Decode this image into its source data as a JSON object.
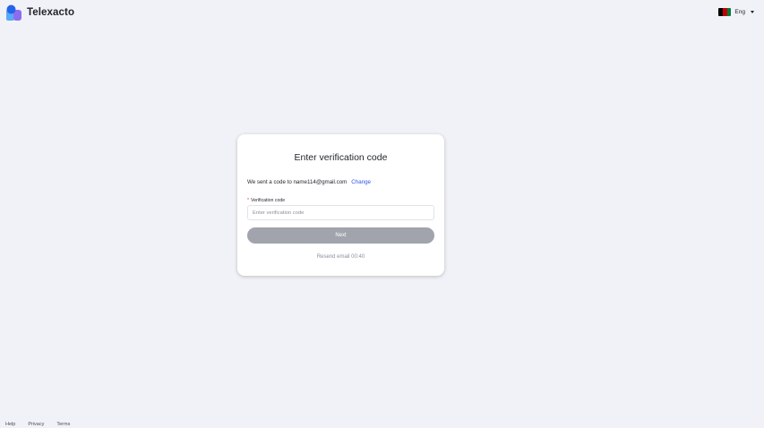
{
  "header": {
    "brand": "Telexacto",
    "language": {
      "label": "Eng",
      "flag_colors": [
        "#000000",
        "#be0000",
        "#007a36"
      ]
    }
  },
  "card": {
    "title": "Enter verification code",
    "sent_text": "We sent a code to name114@gmail.com",
    "change_label": "Change",
    "field_required_mark": "*",
    "field_label": "Verification code",
    "field_placeholder": "Enter verification code",
    "field_value": "",
    "next_label": "Next",
    "resend_text": "Resend email 00:40"
  },
  "footer": {
    "links": [
      "Help",
      "Privacy",
      "Terms"
    ]
  },
  "colors": {
    "background": "#f1f2f7",
    "link": "#2f54eb",
    "button_disabled": "#a1a4ac",
    "logo_dark": "#2563eb",
    "logo_light": "#5aa9f5",
    "logo_purple": "#8b6cf1"
  }
}
